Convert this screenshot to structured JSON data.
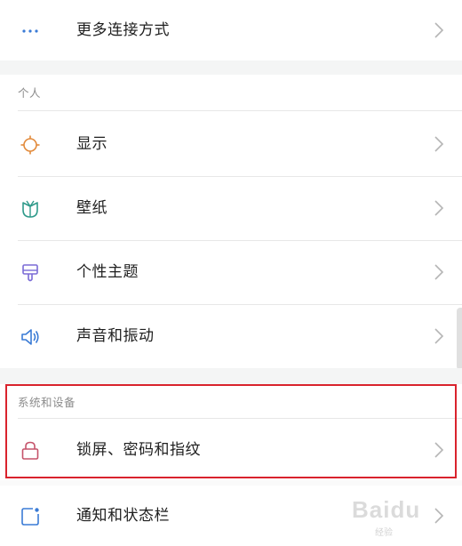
{
  "rows": {
    "more_connections": {
      "label": "更多连接方式",
      "icon": "more-dots-icon"
    },
    "display": {
      "label": "显示",
      "icon": "sun-icon"
    },
    "wallpaper": {
      "label": "壁纸",
      "icon": "tulip-icon"
    },
    "themes": {
      "label": "个性主题",
      "icon": "brush-icon"
    },
    "sound": {
      "label": "声音和振动",
      "icon": "speaker-icon"
    },
    "lockscreen": {
      "label": "锁屏、密码和指纹",
      "icon": "lock-icon"
    },
    "notifications": {
      "label": "通知和状态栏",
      "icon": "notification-icon"
    }
  },
  "sections": {
    "personal": "个人",
    "system": "系统和设备"
  },
  "watermark": {
    "brand": "Baidu",
    "sub": "经验"
  },
  "colors": {
    "highlight": "#d9232d",
    "sun": "#e28a3b",
    "tulip": "#2f9a8a",
    "brush": "#7b6cd6",
    "speaker": "#3a7bd5",
    "lock": "#c5536a",
    "notification": "#3a7bd5",
    "dots": "#3a7bd5"
  }
}
